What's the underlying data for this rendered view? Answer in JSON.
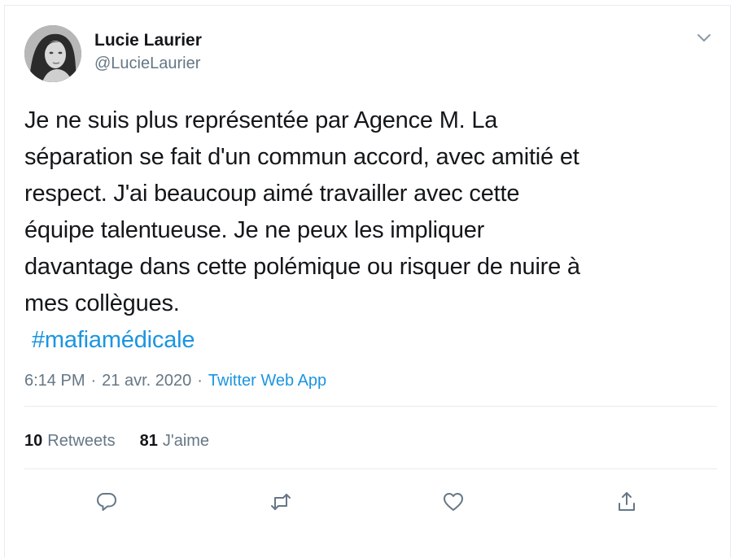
{
  "author": {
    "display_name": "Lucie Laurier",
    "handle": "@LucieLaurier"
  },
  "tweet": {
    "text_lines": [
      "Je ne suis plus représentée par Agence M. La",
      "séparation se fait d'un commun accord, avec amitié et",
      "respect. J'ai beaucoup aimé travailler avec cette",
      "équipe talentueuse. Je ne peux les impliquer",
      "davantage dans cette polémique ou risquer de nuire à",
      "mes collègues."
    ],
    "hashtag": "#mafiamédicale"
  },
  "meta": {
    "time": "6:14 PM",
    "separator": "·",
    "date": "21 avr. 2020",
    "source": "Twitter Web App"
  },
  "stats": {
    "retweets_count": "10",
    "retweets_label": "Retweets",
    "likes_count": "81",
    "likes_label": "J'aime"
  },
  "actions": {
    "icons": [
      "reply-icon",
      "retweet-icon",
      "like-icon",
      "share-icon"
    ]
  },
  "colors": {
    "text": "#14171a",
    "secondary": "#657786",
    "link": "#1b95e0",
    "border": "#e6ecf0"
  }
}
